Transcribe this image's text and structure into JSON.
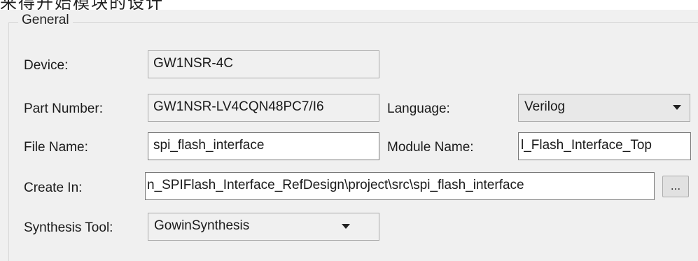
{
  "top_cut_text": "来得开始模块的设计",
  "group": {
    "title": "General"
  },
  "device": {
    "label": "Device:",
    "value": "GW1NSR-4C"
  },
  "part_number": {
    "label": "Part Number:",
    "value": "GW1NSR-LV4CQN48PC7/I6"
  },
  "language": {
    "label": "Language:",
    "value": "Verilog"
  },
  "file_name": {
    "label": "File Name:",
    "value": "spi_flash_interface"
  },
  "module_name": {
    "label": "Module Name:",
    "value": "l_Flash_Interface_Top"
  },
  "create_in": {
    "label": "Create In:",
    "value": "n_SPIFlash_Interface_RefDesign\\project\\src\\spi_flash_interface",
    "browse_label": "..."
  },
  "synthesis_tool": {
    "label": "Synthesis Tool:",
    "value": "GowinSynthesis"
  }
}
